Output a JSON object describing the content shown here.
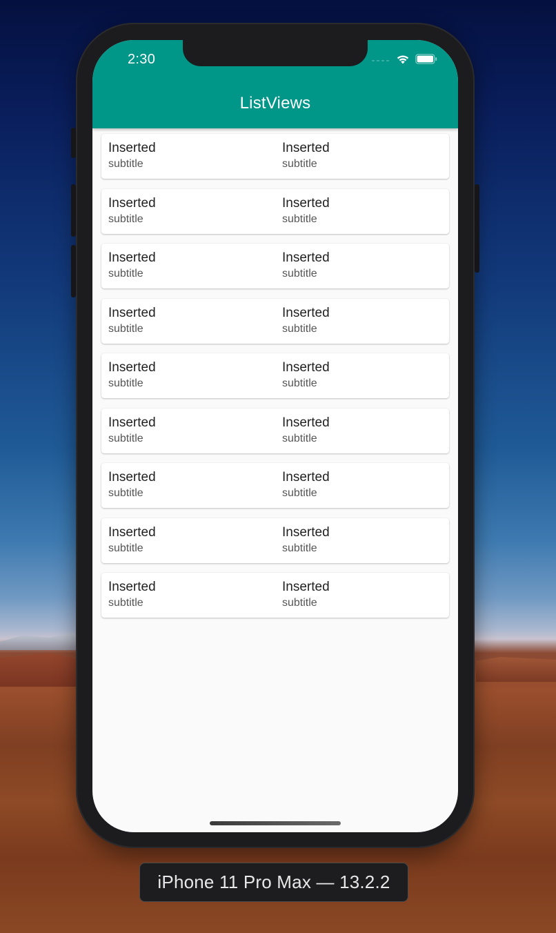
{
  "status_bar": {
    "time": "2:30",
    "icons": [
      "wifi-icon",
      "battery-icon"
    ]
  },
  "app_bar": {
    "title": "ListViews",
    "color": "#009688"
  },
  "list": {
    "rows": [
      {
        "left": {
          "title": "Inserted",
          "subtitle": "subtitle"
        },
        "right": {
          "title": "Inserted",
          "subtitle": "subtitle"
        }
      },
      {
        "left": {
          "title": "Inserted",
          "subtitle": "subtitle"
        },
        "right": {
          "title": "Inserted",
          "subtitle": "subtitle"
        }
      },
      {
        "left": {
          "title": "Inserted",
          "subtitle": "subtitle"
        },
        "right": {
          "title": "Inserted",
          "subtitle": "subtitle"
        }
      },
      {
        "left": {
          "title": "Inserted",
          "subtitle": "subtitle"
        },
        "right": {
          "title": "Inserted",
          "subtitle": "subtitle"
        }
      },
      {
        "left": {
          "title": "Inserted",
          "subtitle": "subtitle"
        },
        "right": {
          "title": "Inserted",
          "subtitle": "subtitle"
        }
      },
      {
        "left": {
          "title": "Inserted",
          "subtitle": "subtitle"
        },
        "right": {
          "title": "Inserted",
          "subtitle": "subtitle"
        }
      },
      {
        "left": {
          "title": "Inserted",
          "subtitle": "subtitle"
        },
        "right": {
          "title": "Inserted",
          "subtitle": "subtitle"
        }
      },
      {
        "left": {
          "title": "Inserted",
          "subtitle": "subtitle"
        },
        "right": {
          "title": "Inserted",
          "subtitle": "subtitle"
        }
      },
      {
        "left": {
          "title": "Inserted",
          "subtitle": "subtitle"
        },
        "right": {
          "title": "Inserted",
          "subtitle": "subtitle"
        }
      }
    ]
  },
  "simulator": {
    "device_label": "iPhone 11 Pro Max — 13.2.2"
  }
}
